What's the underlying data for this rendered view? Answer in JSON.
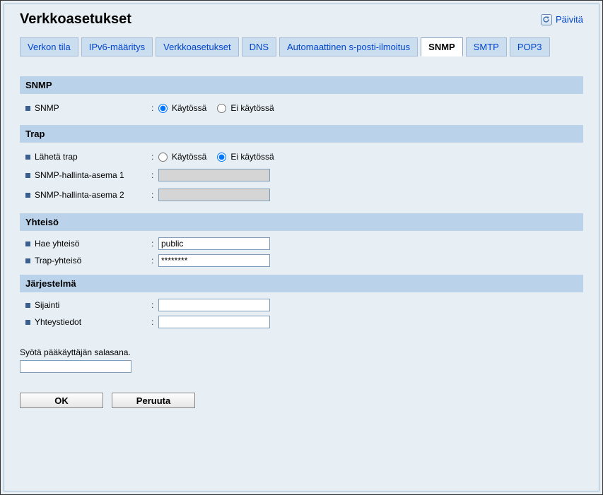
{
  "header": {
    "title": "Verkkoasetukset",
    "refresh": "Päivitä"
  },
  "tabs": [
    {
      "label": "Verkon tila",
      "active": false
    },
    {
      "label": "IPv6-määritys",
      "active": false
    },
    {
      "label": "Verkkoasetukset",
      "active": false
    },
    {
      "label": "DNS",
      "active": false
    },
    {
      "label": "Automaattinen s-posti-ilmoitus",
      "active": false
    },
    {
      "label": "SNMP",
      "active": true
    },
    {
      "label": "SMTP",
      "active": false
    },
    {
      "label": "POP3",
      "active": false
    }
  ],
  "sections": {
    "snmp": {
      "title": "SNMP",
      "rows": {
        "snmp": {
          "label": "SNMP",
          "opt_on": "Käytössä",
          "opt_off": "Ei käytössä",
          "value": "on"
        }
      }
    },
    "trap": {
      "title": "Trap",
      "rows": {
        "send_trap": {
          "label": "Lähetä trap",
          "opt_on": "Käytössä",
          "opt_off": "Ei käytössä",
          "value": "off"
        },
        "station1": {
          "label": "SNMP-hallinta-asema 1",
          "value": ""
        },
        "station2": {
          "label": "SNMP-hallinta-asema 2",
          "value": ""
        }
      }
    },
    "community": {
      "title": "Yhteisö",
      "rows": {
        "get": {
          "label": "Hae yhteisö",
          "value": "public"
        },
        "trap": {
          "label": "Trap-yhteisö",
          "value": "********"
        }
      }
    },
    "system": {
      "title": "Järjestelmä",
      "rows": {
        "location": {
          "label": "Sijainti",
          "value": ""
        },
        "contact": {
          "label": "Yhteystiedot",
          "value": ""
        }
      }
    }
  },
  "admin": {
    "prompt": "Syötä pääkäyttäjän salasana.",
    "value": ""
  },
  "buttons": {
    "ok": "OK",
    "cancel": "Peruuta"
  }
}
